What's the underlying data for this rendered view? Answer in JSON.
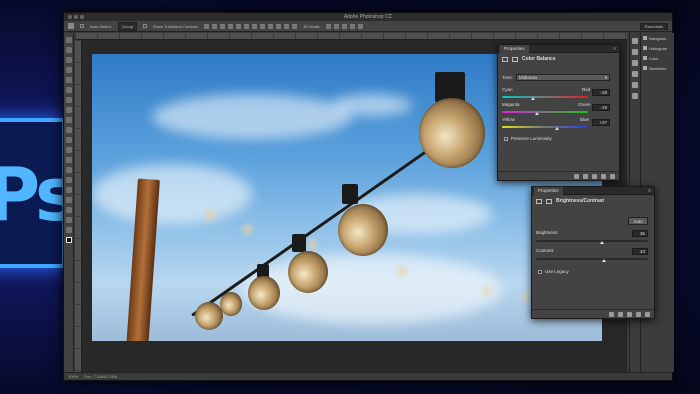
{
  "app": {
    "title": "Adobe Photoshop CC",
    "workspace": "Essentials",
    "logo_text": "Ps"
  },
  "options_bar": {
    "auto_select_label": "Auto-Select:",
    "auto_select_value": "Group",
    "show_transform_label": "Show Transform Controls",
    "mode_label": "3D Mode:"
  },
  "status_bar": {
    "zoom": "100%",
    "doc_info": "Doc: 7.31M/7.31M"
  },
  "panel_list": {
    "items": [
      {
        "label": "Navigator"
      },
      {
        "label": "Histogram"
      },
      {
        "label": "Color"
      },
      {
        "label": "Swatches"
      }
    ]
  },
  "color_balance": {
    "tab": "Properties",
    "title": "Color Balance",
    "tone_label": "Tone:",
    "tone_value": "Midtones",
    "rows": [
      {
        "left": "Cyan",
        "right": "Red",
        "value": "-28",
        "level": 0.36,
        "color_left": "#00c8c8",
        "color_right": "#e02020"
      },
      {
        "left": "Magenta",
        "right": "Green",
        "value": "-18",
        "level": 0.41,
        "color_left": "#e020e0",
        "color_right": "#20c020"
      },
      {
        "left": "Yellow",
        "right": "Blue",
        "value": "+27",
        "level": 0.635,
        "color_left": "#e0e020",
        "color_right": "#2040e0"
      }
    ],
    "preserve_label": "Preserve Luminosity",
    "preserve_checked": true
  },
  "brightness_contrast": {
    "tab": "Properties",
    "title": "Brightness/Contrast",
    "auto_label": "Auto",
    "brightness_label": "Brightness:",
    "brightness_value": "36",
    "brightness_level": 0.59,
    "contrast_label": "Contrast:",
    "contrast_value": "34",
    "contrast_level": 0.61,
    "legacy_label": "Use Legacy",
    "legacy_checked": false
  }
}
